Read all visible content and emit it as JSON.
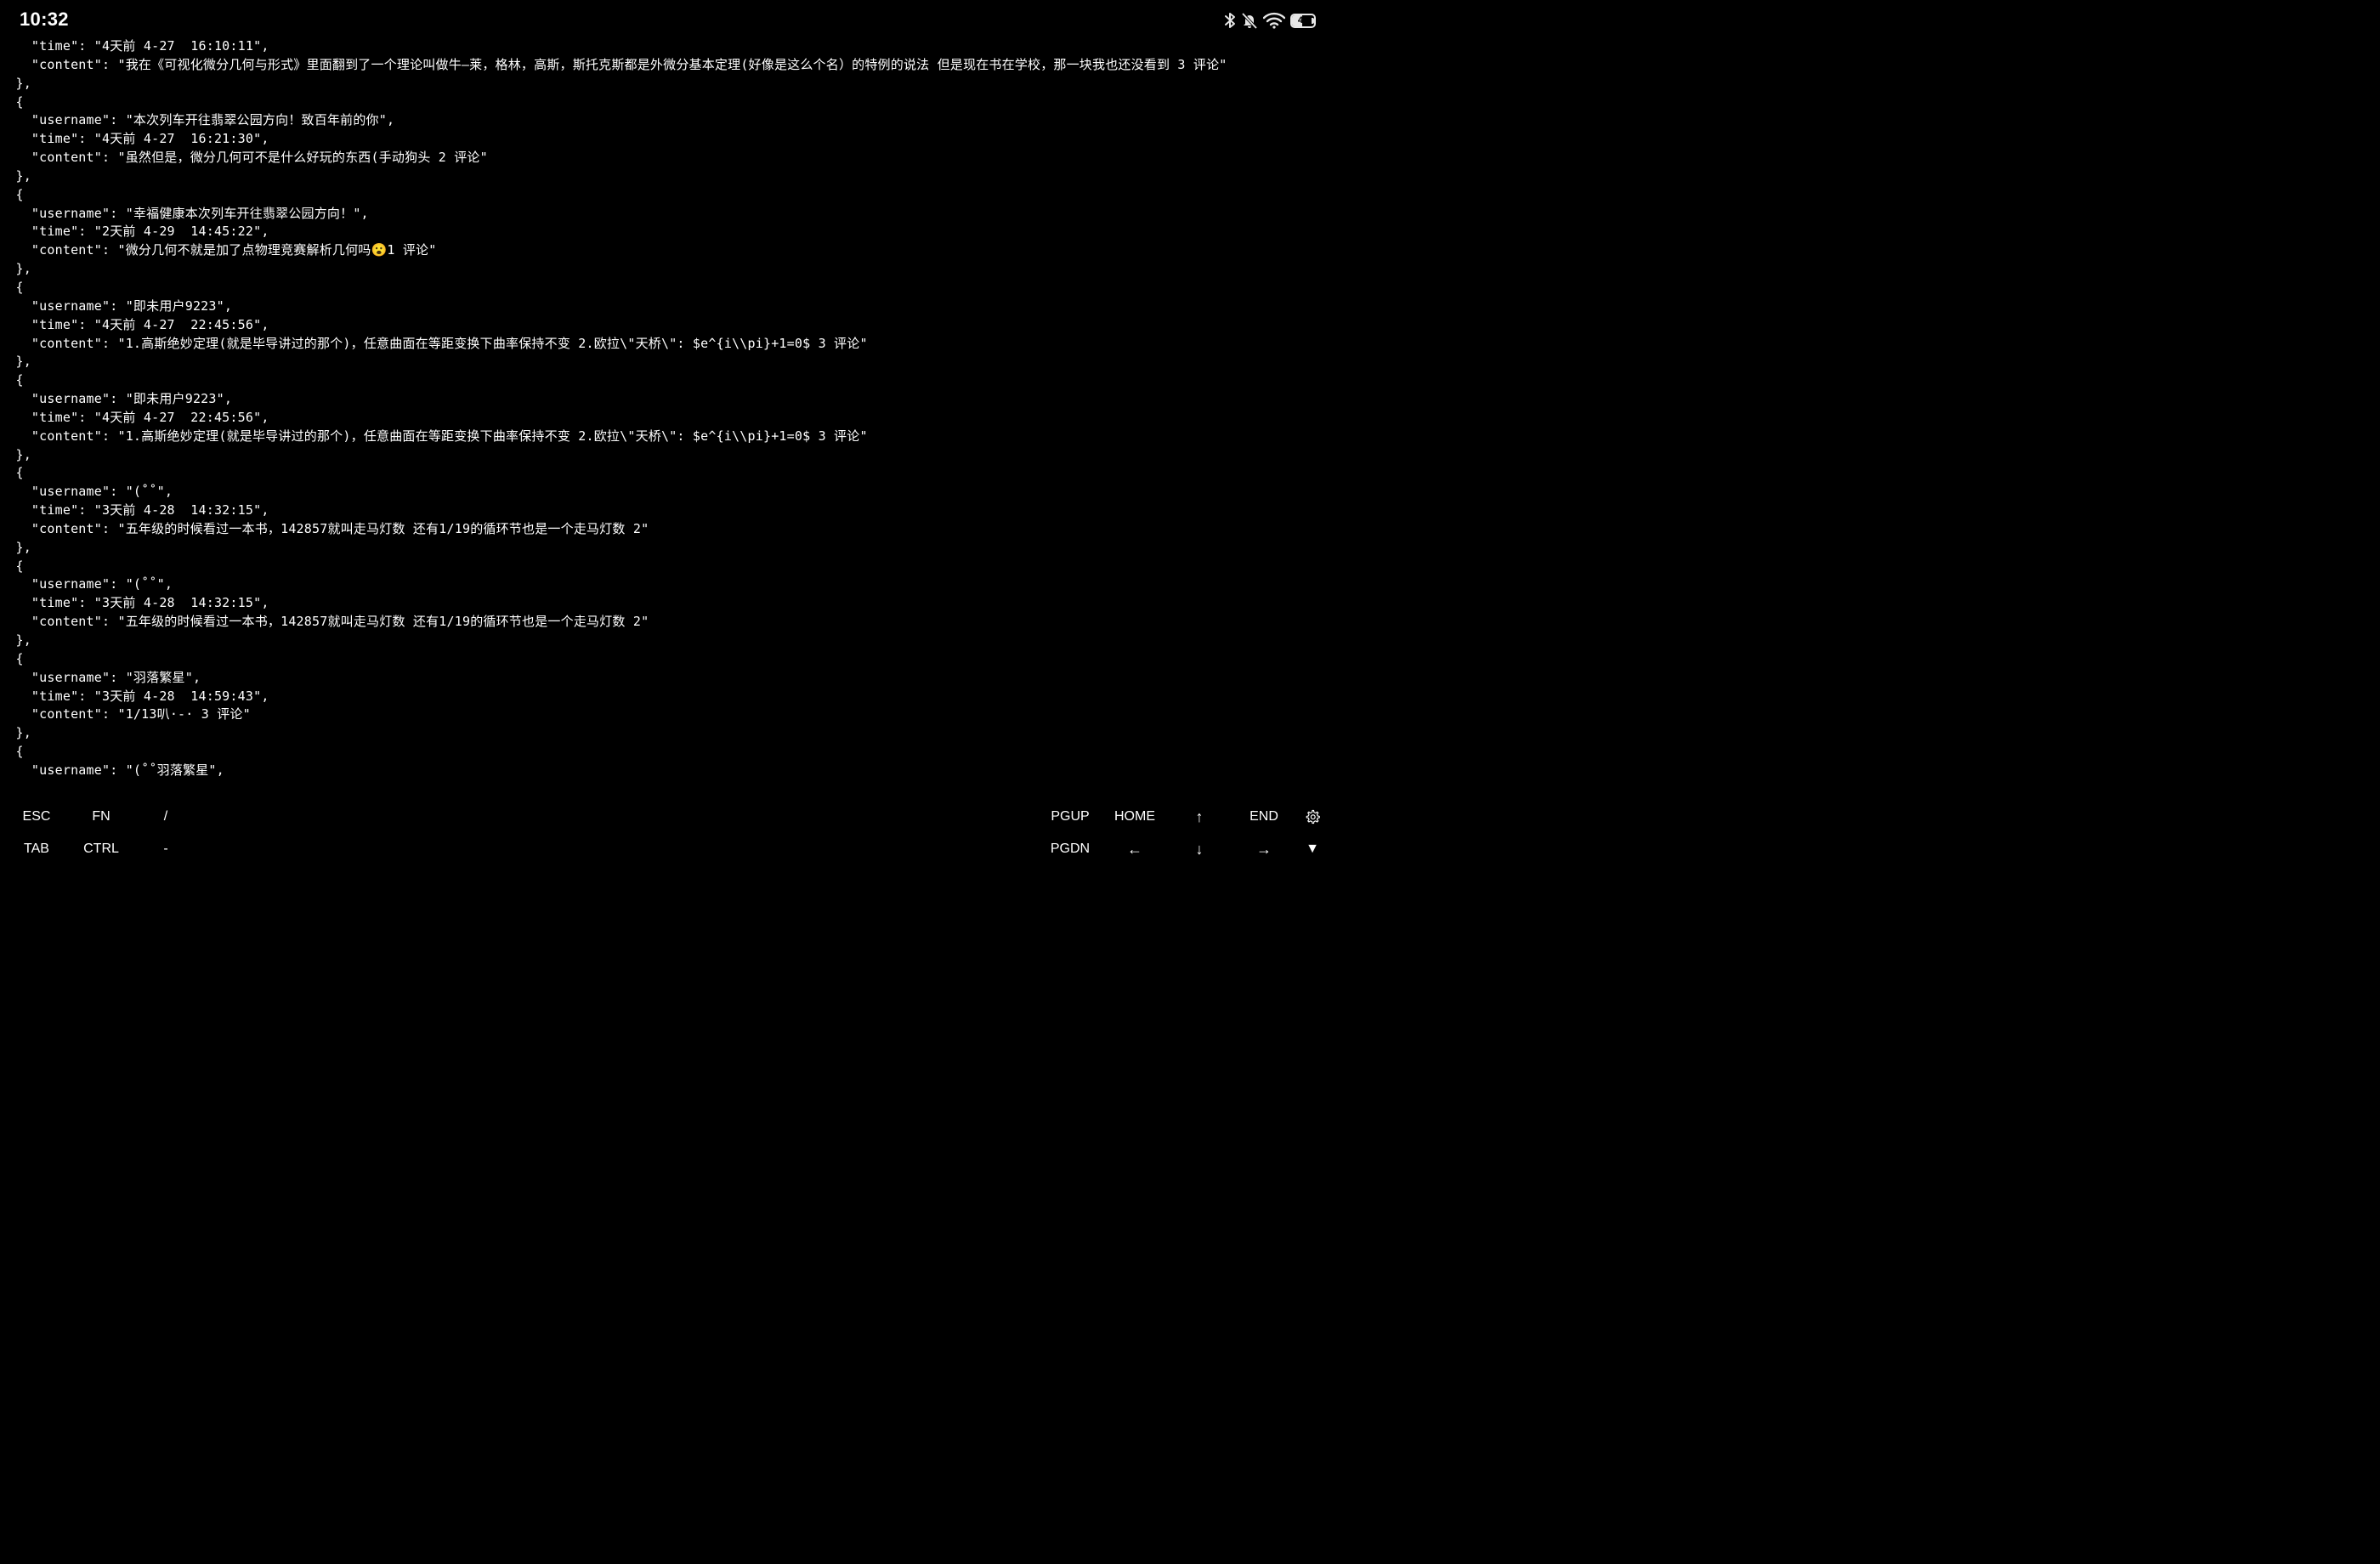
{
  "status_bar": {
    "time": "10:32",
    "battery_level": "47",
    "battery_fraction": 0.47,
    "icons": [
      "bluetooth-icon",
      "bell-muted-icon",
      "wifi-icon",
      "battery-icon"
    ]
  },
  "terminal": {
    "lines": [
      "    \"time\": \"4天前 4-27  16:10:11\",",
      "    \"content\": \"我在《可视化微分几何与形式》里面翻到了一个理论叫做牛—莱，格林，高斯，斯托克斯都是外微分基本定理(好像是这么个名）的特例的说法 但是现在书在学校，那一块我也还没看到 3 评论\"",
      "  },",
      "  {",
      "    \"username\": \"本次列车开往翡翠公园方向！致百年前的你\",",
      "    \"time\": \"4天前 4-27  16:21:30\",",
      "    \"content\": \"虽然但是，微分几何可不是什么好玩的东西(手动狗头 2 评论\"",
      "  },",
      "  {",
      "    \"username\": \"幸福健康本次列车开往翡翠公园方向！\",",
      "    \"time\": \"2天前 4-29  14:45:22\",",
      "    \"content\": \"微分几何不就是加了点物理竞赛解析几何吗😮1 评论\"",
      "  },",
      "  {",
      "    \"username\": \"即未用户9223\",",
      "    \"time\": \"4天前 4-27  22:45:56\",",
      "    \"content\": \"1.高斯绝妙定理(就是毕导讲过的那个)，任意曲面在等距变换下曲率保持不变 2.欧拉\\\"天桥\\\": $e^{i\\\\pi}+1=0$ 3 评论\"",
      "  },",
      "  {",
      "    \"username\": \"即未用户9223\",",
      "    \"time\": \"4天前 4-27  22:45:56\",",
      "    \"content\": \"1.高斯绝妙定理(就是毕导讲过的那个)，任意曲面在等距变换下曲率保持不变 2.欧拉\\\"天桥\\\": $e^{i\\\\pi}+1=0$ 3 评论\"",
      "  },",
      "  {",
      "    \"username\": \"(˚˚\",",
      "    \"time\": \"3天前 4-28  14:32:15\",",
      "    \"content\": \"五年级的时候看过一本书，142857就叫走马灯数 还有1/19的循环节也是一个走马灯数 2\"",
      "  },",
      "  {",
      "    \"username\": \"(˚˚\",",
      "    \"time\": \"3天前 4-28  14:32:15\",",
      "    \"content\": \"五年级的时候看过一本书，142857就叫走马灯数 还有1/19的循环节也是一个走马灯数 2\"",
      "  },",
      "  {",
      "    \"username\": \"羽落繁星\",",
      "    \"time\": \"3天前 4-28  14:59:43\",",
      "    \"content\": \"1/13叭·-· 3 评论\"",
      "  },",
      "  {",
      "    \"username\": \"(˚˚羽落繁星\","
    ]
  },
  "extra_keys": {
    "row1": {
      "esc": "ESC",
      "fn": "FN",
      "slash": "/",
      "pgup": "PGUP",
      "home": "HOME",
      "up": "↑",
      "end": "END",
      "settings_icon": "gear-icon"
    },
    "row2": {
      "tab": "TAB",
      "ctrl": "CTRL",
      "minus": "-",
      "pgdn": "PGDN",
      "left": "←",
      "down": "↓",
      "right": "→",
      "collapse": "▼"
    }
  }
}
